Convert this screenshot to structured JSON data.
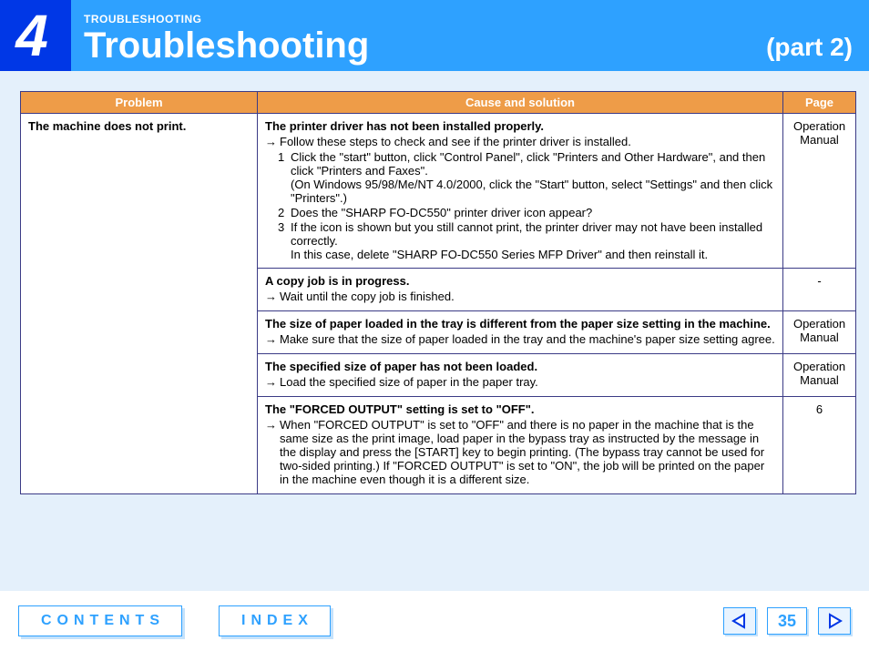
{
  "header": {
    "chapter_number": "4",
    "section_label": "TROUBLESHOOTING",
    "title": "Troubleshooting",
    "part": "(part 2)"
  },
  "table": {
    "headers": {
      "problem": "Problem",
      "cause": "Cause and solution",
      "page": "Page"
    },
    "problem": "The machine does not print.",
    "rows": [
      {
        "title": "The printer driver has not been installed properly.",
        "action": "Follow these steps to check and see if the printer driver is installed.",
        "steps": [
          {
            "n": "1",
            "text": "Click the \"start\" button, click \"Control Panel\", click \"Printers and Other Hardware\", and then click \"Printers and Faxes\".",
            "sub": "(On Windows 95/98/Me/NT 4.0/2000, click the \"Start\" button, select \"Settings\" and then click \"Printers\".)"
          },
          {
            "n": "2",
            "text": "Does the \"SHARP FO-DC550\" printer driver icon appear?"
          },
          {
            "n": "3",
            "text": "If the icon is shown but you still cannot print, the printer driver may not have been installed correctly.",
            "sub": "In this case, delete \"SHARP FO-DC550 Series MFP Driver\" and then reinstall it."
          }
        ],
        "page": "Operation Manual"
      },
      {
        "title": "A copy job is in progress.",
        "action": "Wait until the copy job is finished.",
        "page": "-"
      },
      {
        "title": "The size of paper loaded in the tray is different from the paper size setting in the machine.",
        "action": "Make sure that the size of paper loaded in the tray and the machine's paper size setting agree.",
        "page": "Operation Manual"
      },
      {
        "title": "The specified size of paper has not been loaded.",
        "action": "Load the specified size of paper in the paper tray.",
        "page": "Operation Manual"
      },
      {
        "title": "The \"FORCED OUTPUT\" setting is set to \"OFF\".",
        "action": "When \"FORCED OUTPUT\" is set to \"OFF\" and there is no paper in the machine that is the same size as the print image, load paper in the bypass tray as instructed by the message in the display and press the [START] key to begin printing. (The bypass tray cannot be used for two-sided printing.) If \"FORCED OUTPUT\" is set to \"ON\", the job will be printed on the paper in the machine even though it is a different size.",
        "page": "6"
      }
    ]
  },
  "footer": {
    "contents": "CONTENTS",
    "index": "INDEX",
    "page_number": "35"
  }
}
